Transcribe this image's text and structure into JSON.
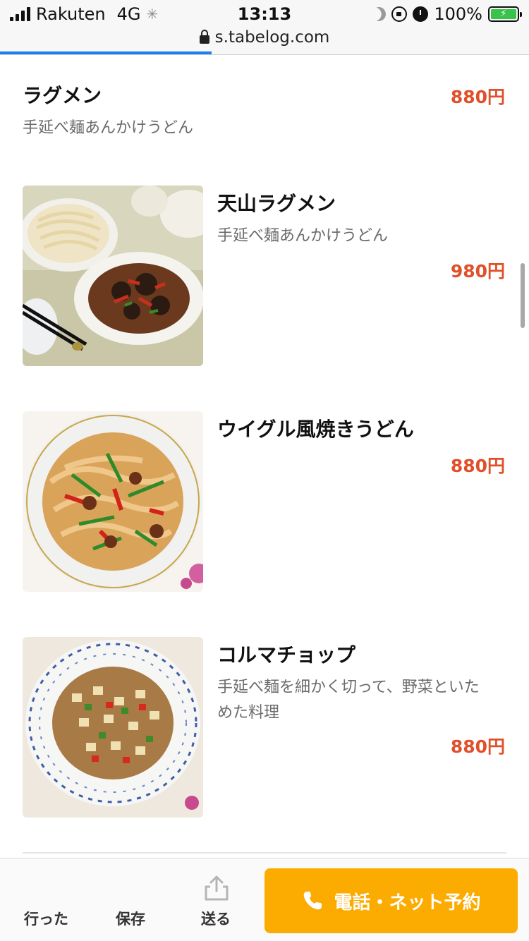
{
  "status_bar": {
    "carrier": "Rakuten",
    "network": "4G",
    "time": "13:13",
    "battery_percent": "100%"
  },
  "url_bar": {
    "domain": "s.tabelog.com",
    "load_progress": 0.4
  },
  "menu_items": [
    {
      "name": "ラグメン",
      "desc": "手延べ麺あんかけうどん",
      "price": "880円",
      "image": "none"
    },
    {
      "name": "天山ラグメン",
      "desc": "手延べ麺あんかけうどん",
      "price": "980円",
      "image": "noodles-with-wood-ear-sauce"
    },
    {
      "name": "ウイグル風焼きうどん",
      "desc": "",
      "price": "880円",
      "image": "stir-fried-udon"
    },
    {
      "name": "コルマチョップ",
      "desc_line1": "手延べ麺を細かく切って、野菜といた",
      "desc_line2": "めた料理",
      "price": "880円",
      "image": "chopped-noodle-stir-fry"
    }
  ],
  "toolbar": {
    "went_label": "行った",
    "save_label": "保存",
    "send_label": "送る",
    "reserve_label": "電話・ネット予約"
  },
  "colors": {
    "price": "#e0502a",
    "reserve_button": "#fcab00",
    "progress": "#1e7ef0"
  }
}
